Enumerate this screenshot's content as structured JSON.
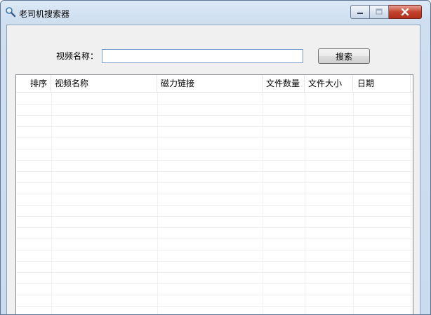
{
  "window": {
    "title": "老司机搜索器",
    "icon": "search-icon"
  },
  "search": {
    "label": "视频名称：",
    "value": "",
    "button_label": "搜索"
  },
  "table": {
    "columns": [
      "排序",
      "视频名称",
      "磁力链接",
      "文件数量",
      "文件大小",
      "日期"
    ],
    "rows": []
  },
  "colors": {
    "title_bar": "#cfdff0",
    "close_button": "#c4432e",
    "client_bg": "#f0f0f0",
    "input_border": "#7a9cc8"
  }
}
